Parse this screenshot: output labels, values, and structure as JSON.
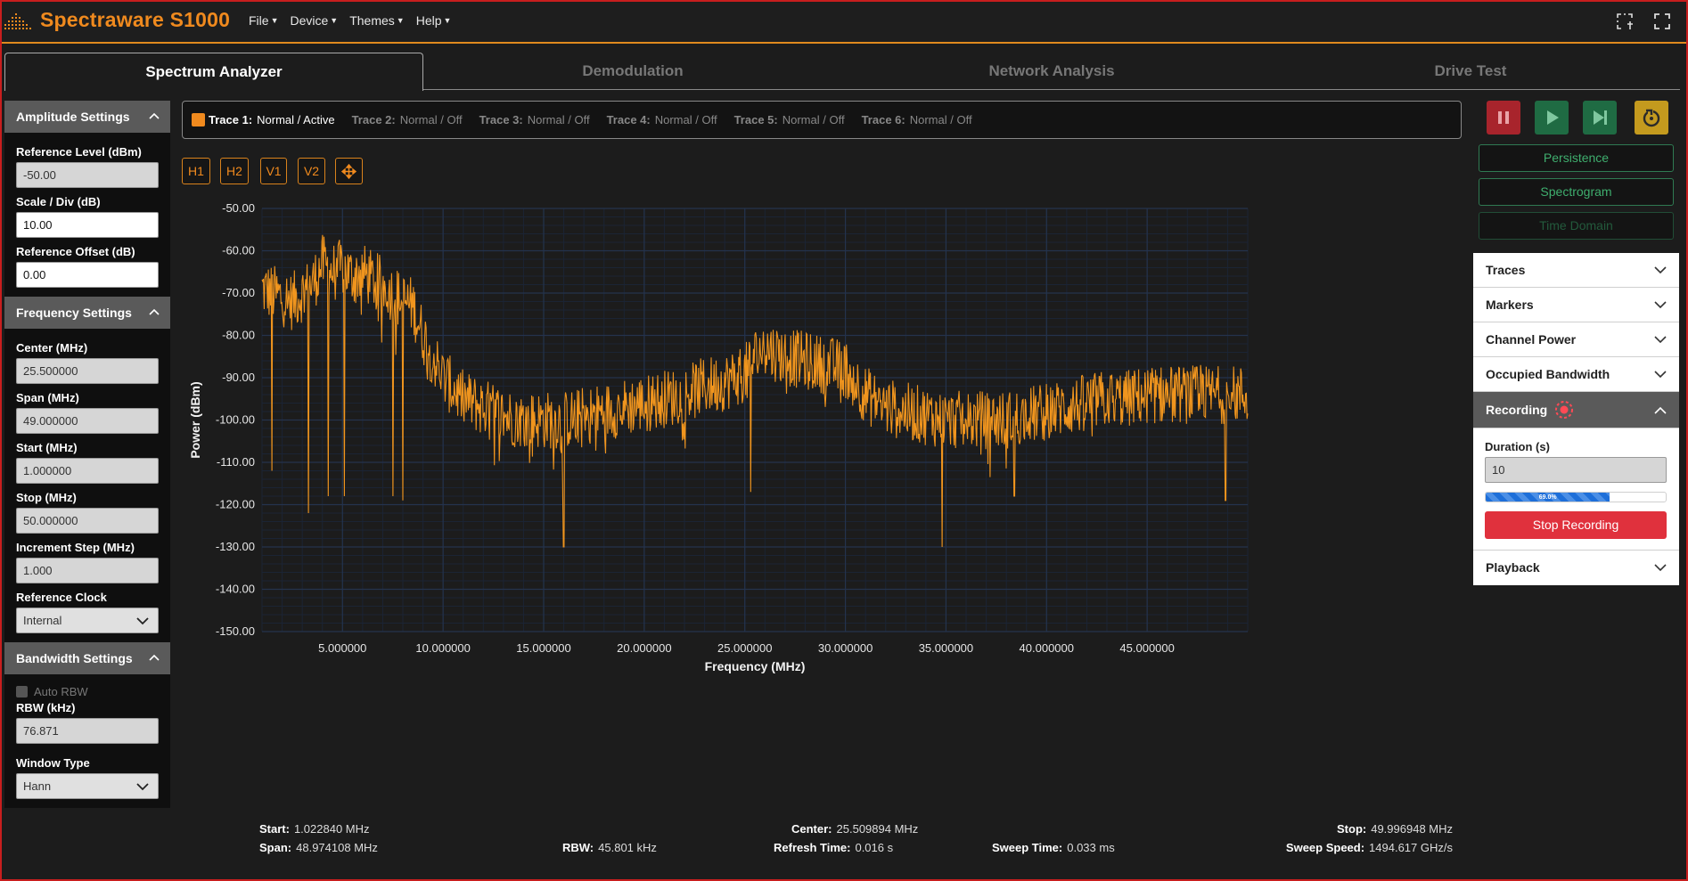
{
  "app": {
    "title": "Spectraware S1000",
    "menu": [
      "File",
      "Device",
      "Themes",
      "Help"
    ],
    "accent_color": "#f08a1e"
  },
  "tabs": [
    {
      "label": "Spectrum Analyzer",
      "active": true
    },
    {
      "label": "Demodulation",
      "active": false
    },
    {
      "label": "Network Analysis",
      "active": false
    },
    {
      "label": "Drive Test",
      "active": false
    }
  ],
  "amplitude": {
    "header": "Amplitude Settings",
    "reference_level_label": "Reference Level (dBm)",
    "reference_level": "-50.00",
    "scale_label": "Scale / Div (dB)",
    "scale": "10.00",
    "offset_label": "Reference Offset (dB)",
    "offset": "0.00"
  },
  "frequency": {
    "header": "Frequency Settings",
    "center_label": "Center (MHz)",
    "center": "25.500000",
    "span_label": "Span (MHz)",
    "span": "49.000000",
    "start_label": "Start (MHz)",
    "start": "1.000000",
    "stop_label": "Stop (MHz)",
    "stop": "50.000000",
    "step_label": "Increment Step (MHz)",
    "step": "1.000",
    "clock_label": "Reference Clock",
    "clock": "Internal"
  },
  "bandwidth": {
    "header": "Bandwidth Settings",
    "auto_rbw_label": "Auto RBW",
    "rbw_label": "RBW (kHz)",
    "rbw": "76.871",
    "window_label": "Window Type",
    "window": "Hann"
  },
  "traces": [
    {
      "name": "Trace 1:",
      "status": "Normal / Active",
      "active": true
    },
    {
      "name": "Trace 2:",
      "status": "Normal / Off",
      "active": false
    },
    {
      "name": "Trace 3:",
      "status": "Normal / Off",
      "active": false
    },
    {
      "name": "Trace 4:",
      "status": "Normal / Off",
      "active": false
    },
    {
      "name": "Trace 5:",
      "status": "Normal / Off",
      "active": false
    },
    {
      "name": "Trace 6:",
      "status": "Normal / Off",
      "active": false
    }
  ],
  "marker_buttons": [
    "H1",
    "H2",
    "V1",
    "V2"
  ],
  "controls": {
    "pause_color": "#a8242c",
    "play_color": "#1f6b43",
    "step_color": "#1f6b43",
    "reset_color": "#c49a1e"
  },
  "modes": [
    {
      "label": "Persistence",
      "enabled": true
    },
    {
      "label": "Spectrogram",
      "enabled": true
    },
    {
      "label": "Time Domain",
      "enabled": false
    }
  ],
  "accordion": {
    "traces": "Traces",
    "markers": "Markers",
    "channel_power": "Channel Power",
    "occupied_bandwidth": "Occupied Bandwidth",
    "recording": "Recording",
    "duration_label": "Duration (s)",
    "duration": "10",
    "progress_percent": 69.0,
    "progress_text": "69.0%",
    "stop_recording": "Stop Recording",
    "playback": "Playback"
  },
  "stats": {
    "start_label": "Start:",
    "start": "1.022840 MHz",
    "span_label": "Span:",
    "span": "48.974108 MHz",
    "rbw_label": "RBW:",
    "rbw": "45.801 kHz",
    "center_label": "Center:",
    "center": "25.509894 MHz",
    "refresh_label": "Refresh Time:",
    "refresh": "0.016 s",
    "sweep_time_label": "Sweep Time:",
    "sweep_time": "0.033 ms",
    "stop_label": "Stop:",
    "stop": "49.996948 MHz",
    "sweep_speed_label": "Sweep Speed:",
    "sweep_speed": "1494.617 GHz/s"
  },
  "chart_data": {
    "type": "line",
    "xlabel": "Frequency (MHz)",
    "ylabel": "Power (dBm)",
    "xlim": [
      1.0,
      50.0
    ],
    "ylim": [
      -150,
      -50
    ],
    "x_ticks": [
      5,
      10,
      15,
      20,
      25,
      30,
      35,
      40,
      45
    ],
    "x_tick_labels": [
      "5.000000",
      "10.000000",
      "15.000000",
      "20.000000",
      "25.000000",
      "30.000000",
      "35.000000",
      "40.000000",
      "45.000000"
    ],
    "y_ticks": [
      -50,
      -60,
      -70,
      -80,
      -90,
      -100,
      -110,
      -120,
      -130,
      -140,
      -150
    ],
    "y_tick_labels": [
      "-50.00",
      "-60.00",
      "-70.00",
      "-80.00",
      "-90.00",
      "-100.00",
      "-110.00",
      "-120.00",
      "-130.00",
      "-140.00",
      "-150.00"
    ],
    "grid": true,
    "trace_color": "#f0951e",
    "series": [
      {
        "x": [
          1.0,
          1.5,
          2.0,
          2.5,
          3.0,
          3.5,
          4.0,
          4.5,
          5.0,
          5.5,
          6.0,
          6.5,
          7.0,
          7.5,
          8.0,
          8.5,
          9.0,
          9.5,
          10.0,
          11.0,
          12.0,
          13.0,
          14.0,
          15.0,
          16.0,
          17.0,
          18.0,
          19.0,
          20.0,
          21.0,
          22.0,
          23.0,
          24.0,
          25.0,
          25.5,
          26.0,
          27.0,
          28.0,
          29.0,
          30.0,
          31.0,
          32.0,
          33.0,
          34.0,
          35.0,
          36.0,
          37.0,
          38.0,
          39.0,
          40.0,
          41.0,
          42.0,
          43.0,
          44.0,
          45.0,
          46.0,
          47.0,
          48.0,
          49.0,
          50.0
        ],
        "y": [
          -69,
          -70,
          -71,
          -72,
          -70,
          -68,
          -63,
          -65,
          -64,
          -66,
          -65,
          -67,
          -68,
          -70,
          -72,
          -73,
          -80,
          -85,
          -90,
          -95,
          -97,
          -99,
          -100,
          -100,
          -100,
          -99,
          -98,
          -97,
          -96,
          -95,
          -94,
          -92,
          -91,
          -89,
          -85,
          -83,
          -85,
          -86,
          -87,
          -88,
          -94,
          -97,
          -98,
          -99,
          -100,
          -100,
          -100,
          -100,
          -99,
          -98,
          -97,
          -96,
          -95,
          -95,
          -94,
          -94,
          -94,
          -94,
          -94,
          -94
        ],
        "spurs": [
          {
            "x": 1.5,
            "y": -112
          },
          {
            "x": 3.3,
            "y": -122
          },
          {
            "x": 4.3,
            "y": -118
          },
          {
            "x": 5.1,
            "y": -118
          },
          {
            "x": 7.5,
            "y": -118
          },
          {
            "x": 8.0,
            "y": -119
          },
          {
            "x": 16.0,
            "y": -130
          },
          {
            "x": 25.3,
            "y": -117
          },
          {
            "x": 34.8,
            "y": -130
          },
          {
            "x": 38.4,
            "y": -118
          },
          {
            "x": 48.9,
            "y": -119
          }
        ]
      }
    ]
  }
}
